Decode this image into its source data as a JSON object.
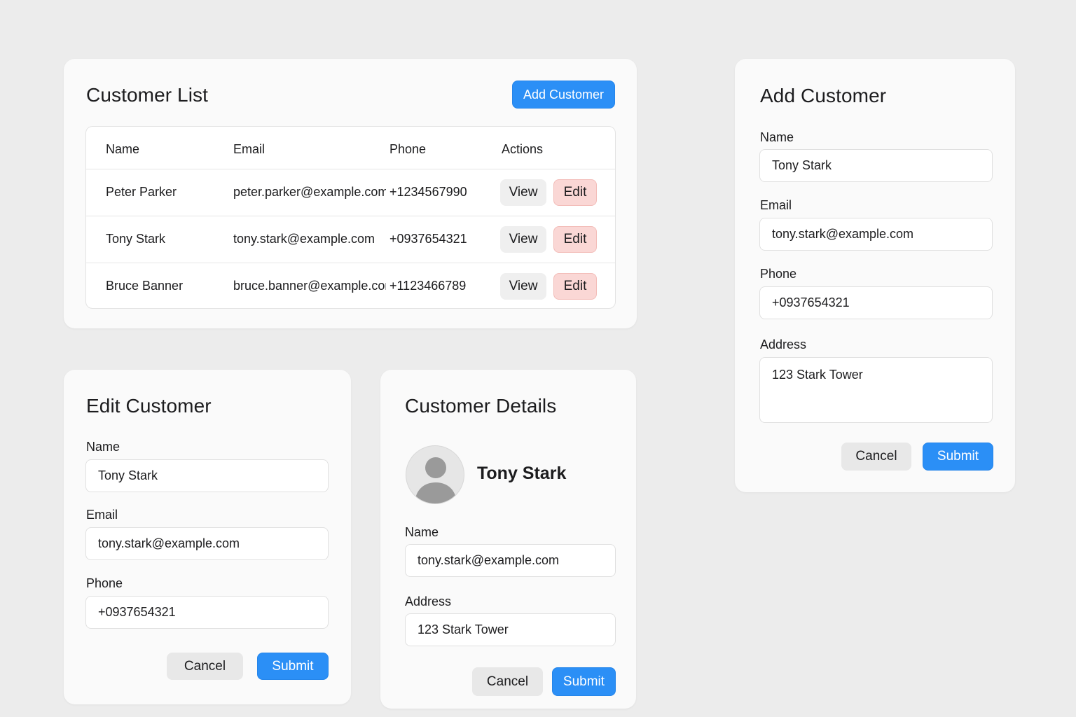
{
  "customer_list": {
    "title": "Customer List",
    "add_button": "Add Customer",
    "columns": [
      "Name",
      "Email",
      "Phone",
      "Actions"
    ],
    "rows": [
      {
        "name": "Peter Parker",
        "email": "peter.parker@example.com",
        "phone": "+1234567990"
      },
      {
        "name": "Tony Stark",
        "email": "tony.stark@example.com",
        "phone": "+0937654321"
      },
      {
        "name": "Bruce Banner",
        "email": "bruce.banner@example.com",
        "phone": "+1123466789"
      }
    ],
    "view_label": "View",
    "edit_label": "Edit"
  },
  "edit_customer": {
    "title": "Edit Customer",
    "name_label": "Name",
    "name_value": "Tony Stark",
    "email_label": "Email",
    "email_value": "tony.stark@example.com",
    "phone_label": "Phone",
    "phone_value": "+0937654321",
    "cancel_label": "Cancel",
    "submit_label": "Submit"
  },
  "customer_details": {
    "title": "Customer Details",
    "display_name": "Tony Stark",
    "name_label": "Name",
    "name_value": "tony.stark@example.com",
    "address_label": "Address",
    "address_value": "123 Stark Tower",
    "cancel_label": "Cancel",
    "submit_label": "Submit"
  },
  "add_customer": {
    "title": "Add Customer",
    "name_label": "Name",
    "name_value": "Tony Stark",
    "email_label": "Email",
    "email_value": "tony.stark@example.com",
    "phone_label": "Phone",
    "phone_value": "+0937654321",
    "address_label": "Address",
    "address_value": "123 Stark Tower",
    "cancel_label": "Cancel",
    "submit_label": "Submit"
  },
  "colors": {
    "primary": "#2b8ff6",
    "danger_bg": "#fad7d5",
    "background": "#ececec",
    "card": "#fafafa"
  }
}
